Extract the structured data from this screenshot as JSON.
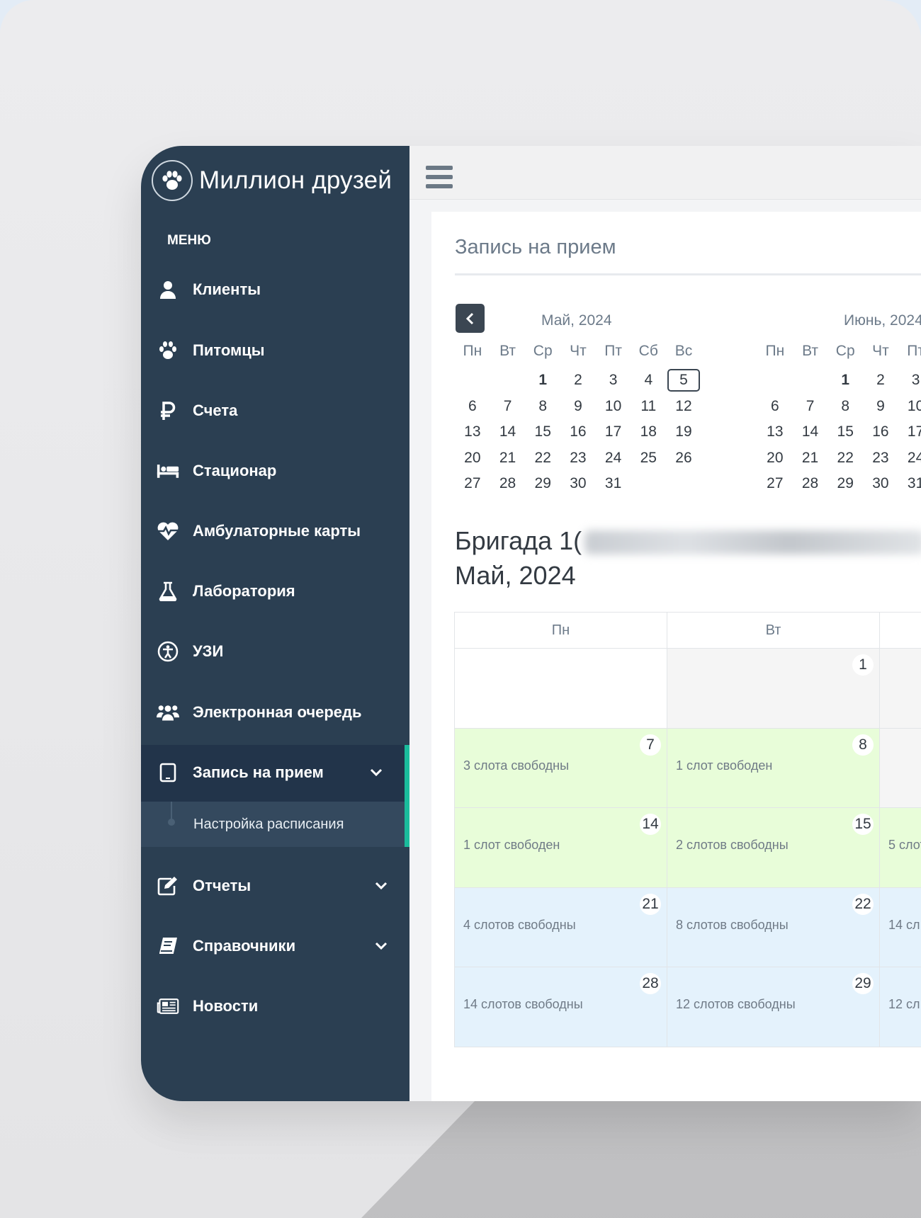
{
  "brand": {
    "name": "Миллион друзей"
  },
  "menu_caption": "МЕНЮ",
  "sidebar": {
    "items": [
      {
        "label": "Клиенты",
        "icon": "user-icon"
      },
      {
        "label": "Питомцы",
        "icon": "paw-icon"
      },
      {
        "label": "Счета",
        "icon": "ruble-icon"
      },
      {
        "label": "Стационар",
        "icon": "bed-icon"
      },
      {
        "label": "Амбулаторные карты",
        "icon": "heartbeat-icon"
      },
      {
        "label": "Лаборатория",
        "icon": "flask-icon"
      },
      {
        "label": "УЗИ",
        "icon": "accessibility-icon"
      },
      {
        "label": "Электронная очередь",
        "icon": "users-icon"
      },
      {
        "label": "Запись на прием",
        "icon": "tablet-icon"
      },
      {
        "label": "Отчеты",
        "icon": "edit-icon"
      },
      {
        "label": "Справочники",
        "icon": "book-icon"
      },
      {
        "label": "Новости",
        "icon": "newspaper-icon"
      }
    ],
    "sub_item": "Настройка расписания"
  },
  "main": {
    "title": "Запись на прием",
    "mini_calendars": [
      {
        "title": "Май, 2024",
        "weekdays": [
          "Пн",
          "Вт",
          "Ср",
          "Чт",
          "Пт",
          "Сб",
          "Вс"
        ]
      },
      {
        "title": "Июнь, 2024",
        "weekdays": [
          "Пн",
          "Вт",
          "Ср",
          "Чт",
          "Пт"
        ]
      }
    ],
    "brigade_title": "Бригада 1(",
    "month_title": "Май, 2024",
    "month_calendar": {
      "weekdays": [
        "Пн",
        "Вт",
        ""
      ],
      "rows": [
        [
          {
            "day": "",
            "text": "",
            "style": "empty"
          },
          {
            "day": "1",
            "text": "",
            "style": "past"
          },
          {
            "day": "",
            "text": "",
            "style": "past"
          }
        ],
        [
          {
            "day": "7",
            "text": "3 слота свободны",
            "style": "green"
          },
          {
            "day": "8",
            "text": "1 слот свободен",
            "style": "green"
          },
          {
            "day": "",
            "text": "",
            "style": "past"
          }
        ],
        [
          {
            "day": "14",
            "text": "1 слот свободен",
            "style": "green"
          },
          {
            "day": "15",
            "text": "2 слотов свободны",
            "style": "green"
          },
          {
            "day": "",
            "text": "5 слот",
            "style": "green"
          }
        ],
        [
          {
            "day": "21",
            "text": "4 слотов свободны",
            "style": "blue"
          },
          {
            "day": "22",
            "text": "8 слотов свободны",
            "style": "blue"
          },
          {
            "day": "",
            "text": "14 сл",
            "style": "blue"
          }
        ],
        [
          {
            "day": "28",
            "text": "14 слотов свободны",
            "style": "blue"
          },
          {
            "day": "29",
            "text": "12 слотов свободны",
            "style": "blue"
          },
          {
            "day": "",
            "text": "12 сл",
            "style": "blue"
          }
        ]
      ]
    }
  },
  "colors": {
    "sidebar_bg": "#2b3f52",
    "active_accent": "#1abc9c",
    "free_green": "#e8fdd9",
    "free_blue": "#e4f2fc"
  }
}
